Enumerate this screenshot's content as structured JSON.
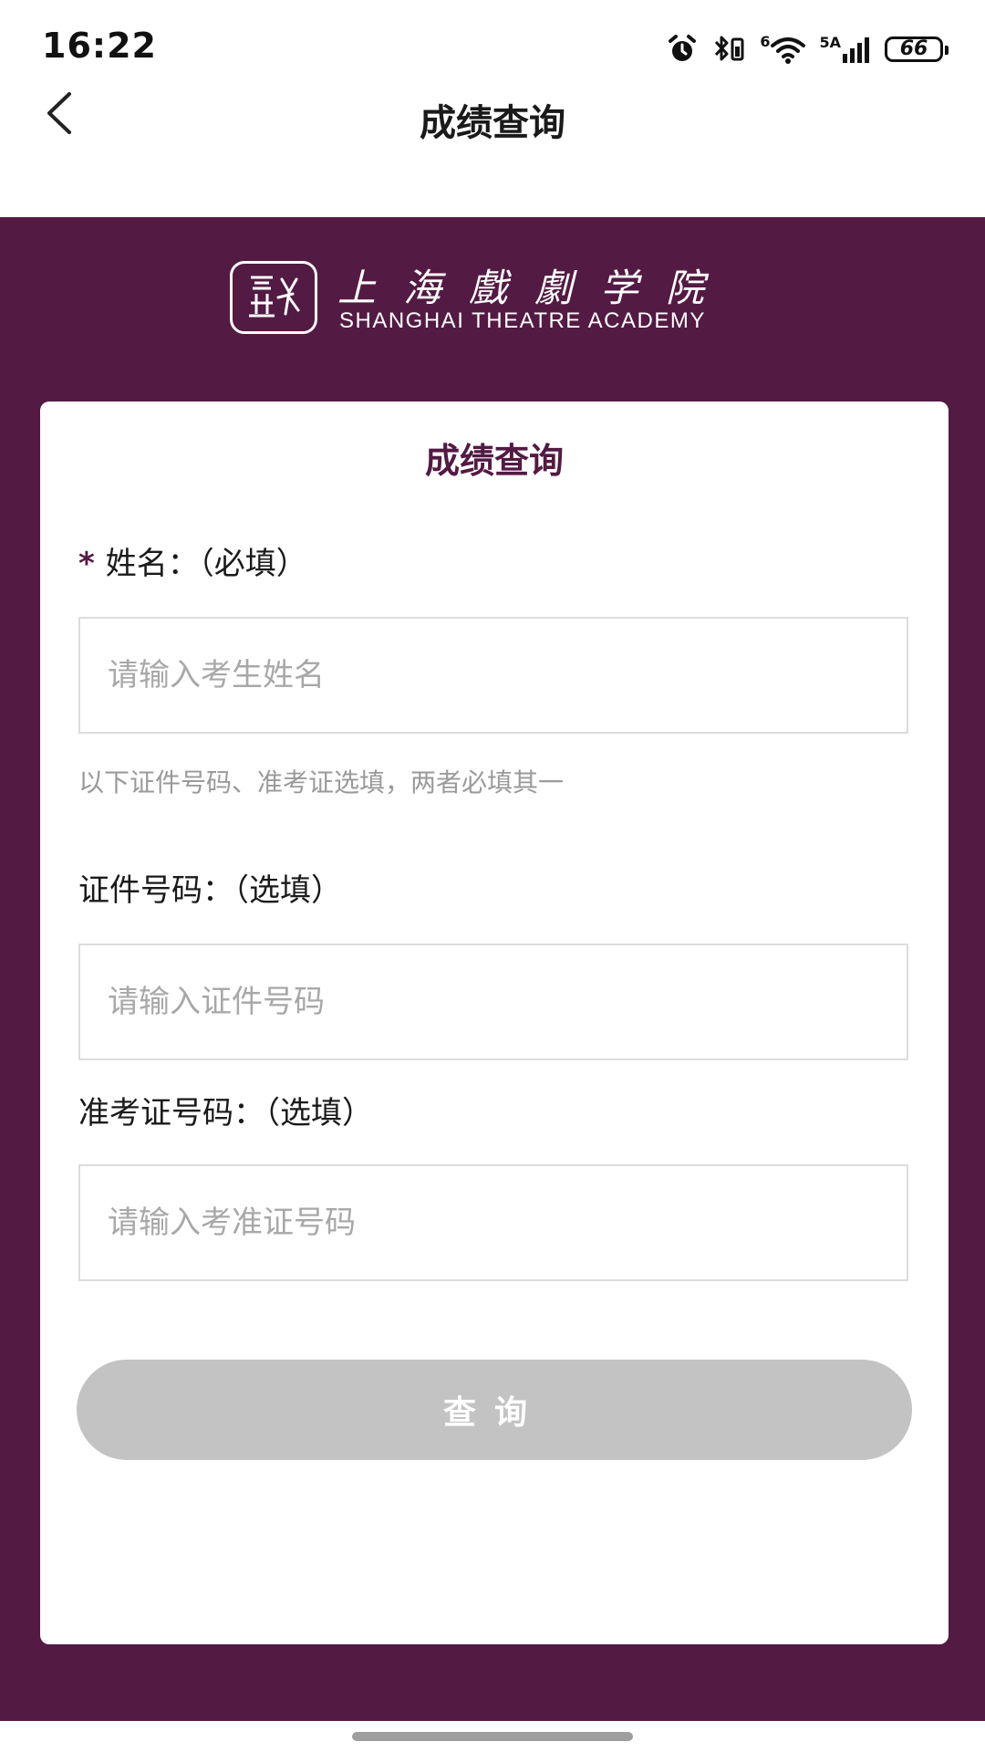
{
  "status_bar": {
    "time": "16:22",
    "network_label": "5A",
    "wifi_label": "6",
    "battery": "66",
    "icons": [
      "alarm-icon",
      "bluetooth-icon",
      "wifi-icon",
      "signal-icon",
      "battery-icon"
    ]
  },
  "nav": {
    "title": "成绩查询",
    "back_icon": "chevron-left-icon"
  },
  "brand": {
    "name_cn": "上海戲劇学院",
    "name_en": "SHANGHAI THEATRE ACADEMY",
    "panel_color": "#531a43"
  },
  "form": {
    "title": "成绩查询",
    "required_mark": "*",
    "name_label": "姓名：（必填）",
    "name_placeholder": "请输入考生姓名",
    "hint": "以下证件号码、准考证选填，两者必填其一",
    "id_label": "证件号码：（选填）",
    "id_placeholder": "请输入证件号码",
    "ticket_label": "准考证号码：（选填）",
    "ticket_placeholder": "请输入考准证号码",
    "submit_label": "查询",
    "submit_color": "#c3c3c3"
  }
}
